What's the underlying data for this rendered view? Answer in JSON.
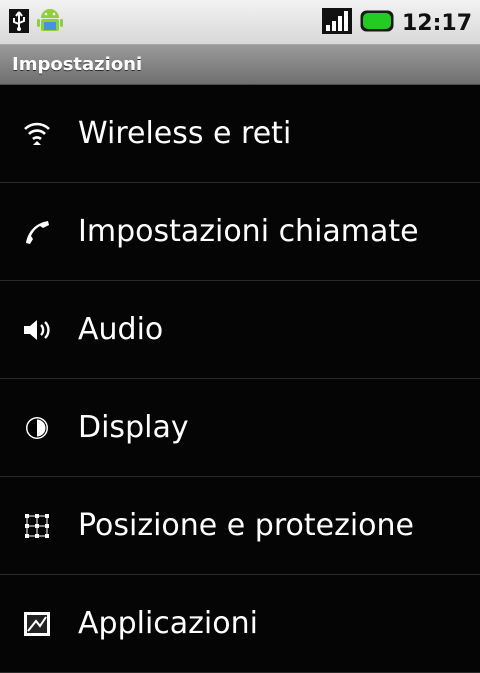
{
  "status_bar": {
    "icons_left": [
      "usb-icon",
      "android-debug-icon"
    ],
    "icons_right": [
      "signal-icon",
      "battery-icon"
    ],
    "time": "12:17",
    "battery_color": "#22cc22"
  },
  "title_bar": {
    "title": "Impostazioni"
  },
  "settings_items": [
    {
      "icon": "wireless-icon",
      "label": "Wireless e reti"
    },
    {
      "icon": "phone-icon",
      "label": "Impostazioni chiamate"
    },
    {
      "icon": "speaker-icon",
      "label": "Audio"
    },
    {
      "icon": "brightness-icon",
      "label": "Display"
    },
    {
      "icon": "location-grid-icon",
      "label": "Posizione e protezione"
    },
    {
      "icon": "applications-icon",
      "label": "Applicazioni"
    }
  ]
}
